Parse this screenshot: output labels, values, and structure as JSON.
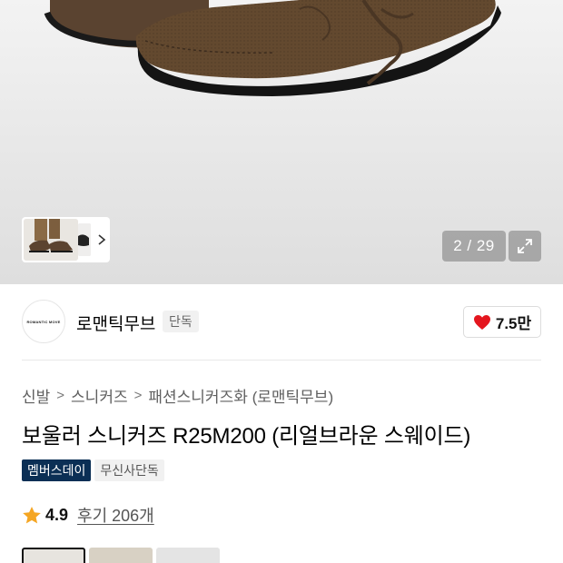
{
  "gallery": {
    "counter": "2 / 29",
    "icons": {
      "expand": "expand-icon",
      "next": "chevron-right-icon"
    }
  },
  "brand": {
    "logo_text": "ROMANTIC MOVE",
    "name": "로맨틱무브",
    "badge": "단독",
    "likes": "7.5만",
    "heart_color": "#e4161e"
  },
  "breadcrumb": [
    "신발",
    "스니커즈",
    "패션스니커즈화 (로맨틱무브)"
  ],
  "product": {
    "title": "보울러 스니커즈 R25M200 (리얼브라운 스웨이드)",
    "tags": [
      "멤버스데이",
      "무신사단독"
    ],
    "rating": "4.9",
    "reviews": "후기 206개",
    "star_color": "#f5a623",
    "tag_color": "#0b2f55"
  }
}
